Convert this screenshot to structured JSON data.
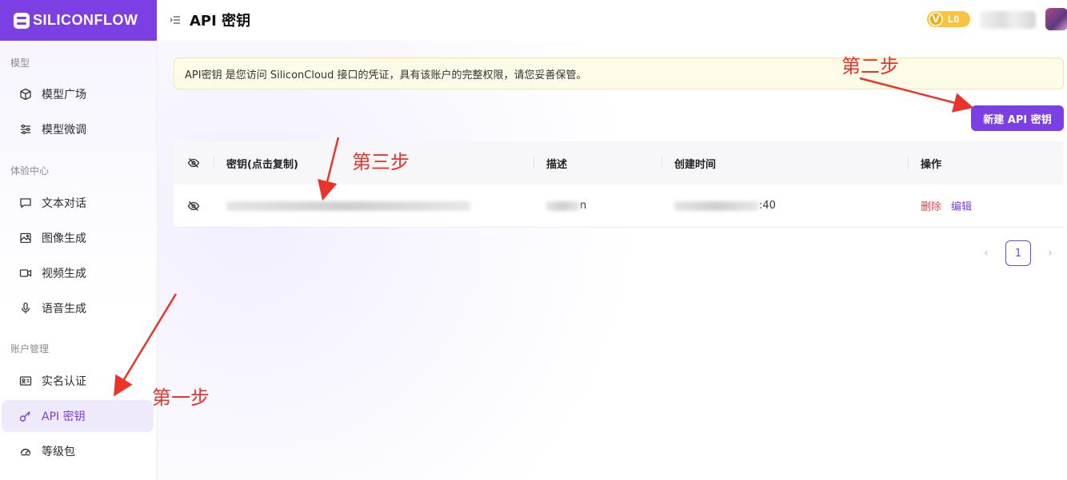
{
  "brand": {
    "logo_text": "SILICONFLOW"
  },
  "header": {
    "title": "API 密钥",
    "level": "L0",
    "level_initial": "V"
  },
  "sidebar": {
    "sections": [
      {
        "title": "模型"
      },
      {
        "title": "体验中心"
      },
      {
        "title": "账户管理"
      }
    ],
    "items": [
      {
        "label": "模型广场",
        "icon": "cube-icon"
      },
      {
        "label": "模型微调",
        "icon": "sliders-icon"
      },
      {
        "label": "文本对话",
        "icon": "chat-icon"
      },
      {
        "label": "图像生成",
        "icon": "image-icon"
      },
      {
        "label": "视频生成",
        "icon": "video-icon"
      },
      {
        "label": "语音生成",
        "icon": "mic-icon"
      },
      {
        "label": "实名认证",
        "icon": "id-card-icon"
      },
      {
        "label": "API 密钥",
        "icon": "key-icon",
        "active": true
      },
      {
        "label": "等级包",
        "icon": "gauge-icon"
      }
    ]
  },
  "main": {
    "notice": "API密钥 是您访问 SiliconCloud 接口的凭证，具有该账户的完整权限，请您妥善保管。",
    "new_key_button": "新建 API 密钥",
    "table": {
      "headers": {
        "key": "密钥(点击复制)",
        "desc": "描述",
        "time": "创建时间",
        "op": "操作"
      },
      "rows": [
        {
          "desc_tail": "n",
          "time_tail": ":40",
          "delete": "删除",
          "edit": "编辑"
        }
      ]
    },
    "pagination": {
      "current": "1",
      "prev": "‹",
      "next": "›"
    }
  },
  "annotations": {
    "step1": "第一步",
    "step2": "第二步",
    "step3": "第三步"
  },
  "colors": {
    "accent": "#7b3fe4",
    "annotation": "#e8342a",
    "danger": "#e5484d"
  }
}
